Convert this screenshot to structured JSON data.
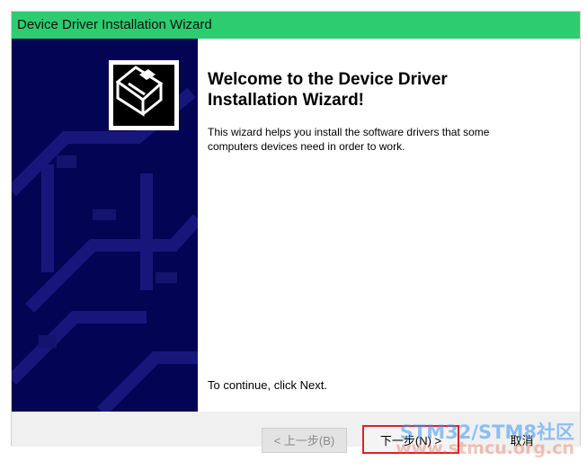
{
  "window": {
    "title": "Device Driver Installation Wizard"
  },
  "content": {
    "heading": "Welcome to the Device Driver Installation Wizard!",
    "description": "This wizard helps you install the software drivers that some computers devices need in order to work.",
    "continue_text": "To continue, click Next."
  },
  "buttons": {
    "back": "< 上一步(B)",
    "next": "下一步(N) >",
    "cancel": "取消"
  },
  "watermark": {
    "line1": "STM32/STM8社区",
    "line2": "www.stmcu.org.cn"
  },
  "icons": {
    "wizard_logo": "hardware-device-icon"
  },
  "colors": {
    "titlebar": "#2ecc71",
    "panel": "#040454",
    "next_highlight": "#e02020"
  }
}
